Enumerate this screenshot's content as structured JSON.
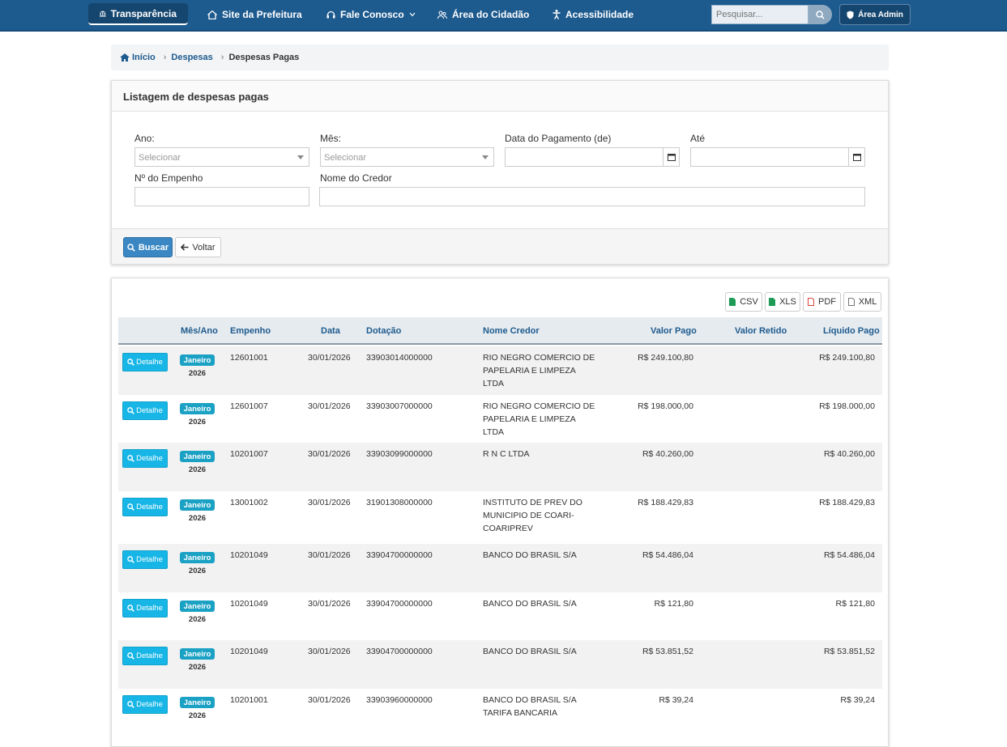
{
  "nav": {
    "items": [
      {
        "label": "Transparência",
        "icon": "bank-icon"
      },
      {
        "label": "Site da Prefeitura",
        "icon": "home-icon"
      },
      {
        "label": "Fale Conosco",
        "icon": "headset-icon"
      },
      {
        "label": "Área do Cidadão",
        "icon": "users-icon"
      },
      {
        "label": "Acessibilidade",
        "icon": "accessibility-icon"
      }
    ],
    "search_placeholder": "Pesquisar...",
    "admin_label": "Área Admin",
    "color_primary": "#1d5a8e"
  },
  "breadcrumb": {
    "home": "Início",
    "level1": "Despesas",
    "current": "Despesas Pagas"
  },
  "filter": {
    "title": "Listagem de despesas pagas",
    "ano_label": "Ano:",
    "ano_value": "Selecionar",
    "mes_label": "Mês:",
    "mes_value": "Selecionar",
    "data_pag_label": "Data do Pagamento (de)",
    "ate_label": "Até",
    "empenho_label": "Nº do Empenho",
    "credor_label": "Nome do Credor",
    "buscar": "Buscar",
    "voltar": "Voltar"
  },
  "export": {
    "csv": "CSV",
    "xls": "XLS",
    "pdf": "PDF",
    "xml": "XML"
  },
  "table": {
    "detail_label": "Detalhe",
    "headers": {
      "mes_ano": "Mês/Ano",
      "empenho": "Empenho",
      "data": "Data",
      "dotacao": "Dotação",
      "credor": "Nome Credor",
      "valor_pago": "Valor Pago",
      "valor_retido": "Valor Retido",
      "liquido": "Líquido Pago"
    },
    "rows": [
      {
        "mes": "Janeiro",
        "ano": "2026",
        "empenho": "12601001",
        "data": "30/01/2026",
        "dotacao": "33903014000000",
        "credor": "RIO NEGRO COMERCIO DE PAPELARIA E LIMPEZA LTDA",
        "valor_pago": "R$ 249.100,80",
        "valor_retido": "",
        "liquido": "R$ 249.100,80"
      },
      {
        "mes": "Janeiro",
        "ano": "2026",
        "empenho": "12601007",
        "data": "30/01/2026",
        "dotacao": "33903007000000",
        "credor": "RIO NEGRO COMERCIO DE PAPELARIA E LIMPEZA LTDA",
        "valor_pago": "R$ 198.000,00",
        "valor_retido": "",
        "liquido": "R$ 198.000,00"
      },
      {
        "mes": "Janeiro",
        "ano": "2026",
        "empenho": "10201007",
        "data": "30/01/2026",
        "dotacao": "33903099000000",
        "credor": "R N C LTDA",
        "valor_pago": "R$ 40.260,00",
        "valor_retido": "",
        "liquido": "R$ 40.260,00"
      },
      {
        "mes": "Janeiro",
        "ano": "2026",
        "empenho": "13001002",
        "data": "30/01/2026",
        "dotacao": "31901308000000",
        "credor": "INSTITUTO DE PREV DO MUNICIPIO DE COARI-COARIPREV",
        "valor_pago": "R$ 188.429,83",
        "valor_retido": "",
        "liquido": "R$ 188.429,83"
      },
      {
        "mes": "Janeiro",
        "ano": "2026",
        "empenho": "10201049",
        "data": "30/01/2026",
        "dotacao": "33904700000000",
        "credor": "BANCO DO BRASIL S/A",
        "valor_pago": "R$ 54.486,04",
        "valor_retido": "",
        "liquido": "R$ 54.486,04"
      },
      {
        "mes": "Janeiro",
        "ano": "2026",
        "empenho": "10201049",
        "data": "30/01/2026",
        "dotacao": "33904700000000",
        "credor": "BANCO DO BRASIL S/A",
        "valor_pago": "R$ 121,80",
        "valor_retido": "",
        "liquido": "R$ 121,80"
      },
      {
        "mes": "Janeiro",
        "ano": "2026",
        "empenho": "10201049",
        "data": "30/01/2026",
        "dotacao": "33904700000000",
        "credor": "BANCO DO BRASIL S/A",
        "valor_pago": "R$ 53.851,52",
        "valor_retido": "",
        "liquido": "R$ 53.851,52"
      },
      {
        "mes": "Janeiro",
        "ano": "2026",
        "empenho": "10201001",
        "data": "30/01/2026",
        "dotacao": "33903960000000",
        "credor": "BANCO DO BRASIL S/A TARIFA BANCARIA",
        "valor_pago": "R$ 39,24",
        "valor_retido": "",
        "liquido": "R$ 39,24"
      }
    ]
  }
}
